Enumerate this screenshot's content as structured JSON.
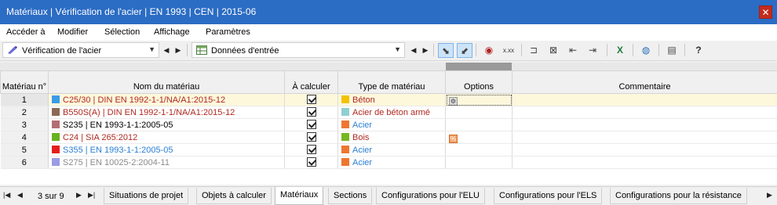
{
  "window": {
    "title": "Matériaux | Vérification de l'acier | EN 1993 | CEN | 2015-06",
    "close_glyph": "✕"
  },
  "menu": [
    "Accéder à",
    "Modifier",
    "Sélection",
    "Affichage",
    "Paramètres"
  ],
  "toolbar": {
    "module_combo": "Vérification de l'acier",
    "table_combo": "Données d'entrée",
    "icons": [
      "select-row-icon",
      "select-column-icon",
      "eye-pin-icon",
      "decimal-format-icon",
      "insert-row-icon",
      "delete-row-icon",
      "move-left-icon",
      "move-right-icon",
      "excel-export-icon",
      "globe-icon",
      "table-settings-icon",
      "help-icon"
    ]
  },
  "table": {
    "headers": {
      "no": "Matériau n°",
      "name": "Nom du matériau",
      "calc": "À calculer",
      "type": "Type de matériau",
      "options": "Options",
      "comment": "Commentaire"
    },
    "rows": [
      {
        "no": "1",
        "name": "C25/30 | DIN EN 1992-1-1/NA/A1:2015-12",
        "swatch": "#3b9be6",
        "name_color": "#b0281f",
        "calc": true,
        "type": "Béton",
        "type_swatch": "#f2c200",
        "type_color": "#b0281f",
        "option": "gear"
      },
      {
        "no": "2",
        "name": "B550S(A) | DIN EN 1992-1-1/NA/A1:2015-12",
        "swatch": "#8c6a55",
        "name_color": "#b0281f",
        "calc": true,
        "type": "Acier de béton armé",
        "type_swatch": "#8fd0d2",
        "type_color": "#b0281f",
        "option": ""
      },
      {
        "no": "3",
        "name": "S235 | EN 1993-1-1:2005-05",
        "swatch": "#b36e73",
        "name_color": "#000000",
        "calc": true,
        "type": "Acier",
        "type_swatch": "#ee7630",
        "type_color": "#2a7fd4",
        "option": ""
      },
      {
        "no": "4",
        "name": "C24 | SIA 265:2012",
        "swatch": "#66b21f",
        "name_color": "#b0281f",
        "calc": true,
        "type": "Bois",
        "type_swatch": "#77b81e",
        "type_color": "#b0281f",
        "option": "wood"
      },
      {
        "no": "5",
        "name": "S355 | EN 1993-1-1:2005-05",
        "swatch": "#e51c1c",
        "name_color": "#2a7fd4",
        "calc": true,
        "type": "Acier",
        "type_swatch": "#ee7630",
        "type_color": "#2a7fd4",
        "option": ""
      },
      {
        "no": "6",
        "name": "S275 | EN 10025-2:2004-11",
        "swatch": "#9b9be6",
        "name_color": "#8a8a8a",
        "calc": true,
        "type": "Acier",
        "type_swatch": "#ee7630",
        "type_color": "#2a7fd4",
        "option": ""
      }
    ]
  },
  "tabs": {
    "count": "3 sur 9",
    "items": [
      "Situations de projet",
      "Objets à calculer",
      "Matériaux",
      "Sections",
      "Configurations pour l'ELU",
      "Configurations pour l'ELS",
      "Configurations pour la résistance"
    ],
    "active": "Matériaux"
  }
}
